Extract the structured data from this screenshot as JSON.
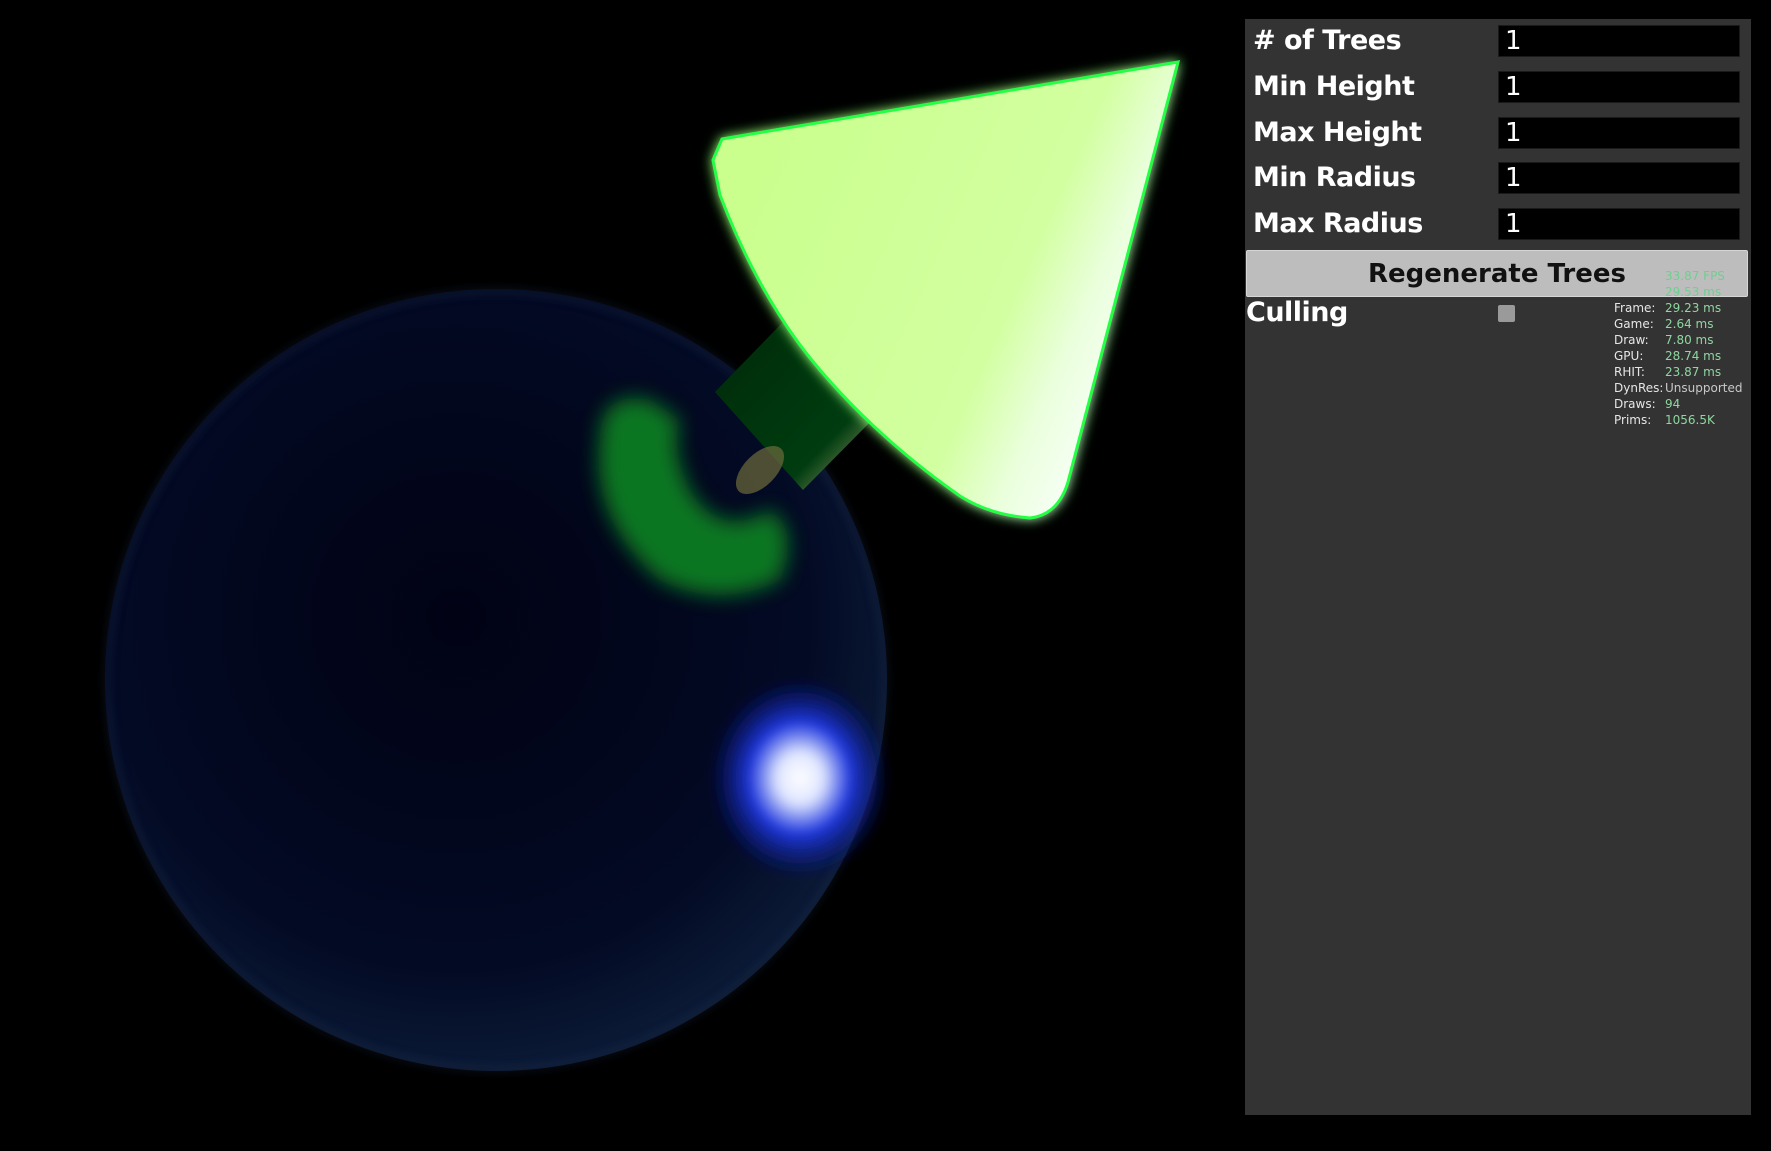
{
  "panel": {
    "fields": [
      {
        "label": "# of Trees",
        "value": "1"
      },
      {
        "label": "Min Height",
        "value": "1"
      },
      {
        "label": "Max Height",
        "value": "1"
      },
      {
        "label": "Min Radius",
        "value": "1"
      },
      {
        "label": "Max Radius",
        "value": "1"
      }
    ],
    "regenerate_label": "Regenerate Trees",
    "culling_label": "Culling",
    "culling_checked": false
  },
  "stats": {
    "fps": "33.87 FPS",
    "ms": "29.53 ms",
    "rows": [
      {
        "key": "Frame:",
        "value": "29.23 ms"
      },
      {
        "key": "Game:",
        "value": "2.64 ms"
      },
      {
        "key": "Draw:",
        "value": "7.80 ms"
      },
      {
        "key": "GPU:",
        "value": "28.74 ms"
      },
      {
        "key": "RHIT:",
        "value": "23.87 ms"
      },
      {
        "key": "DynRes:",
        "value": "Unsupported"
      },
      {
        "key": "Draws:",
        "value": "94"
      },
      {
        "key": "Prims:",
        "value": "1056.5K"
      }
    ]
  },
  "colors": {
    "background": "#000000",
    "panel": "#333333",
    "sphere": "#02051a",
    "cone": "#c8ff8a",
    "glow": "#00ff33",
    "stat_green": "#8fd6a0"
  }
}
